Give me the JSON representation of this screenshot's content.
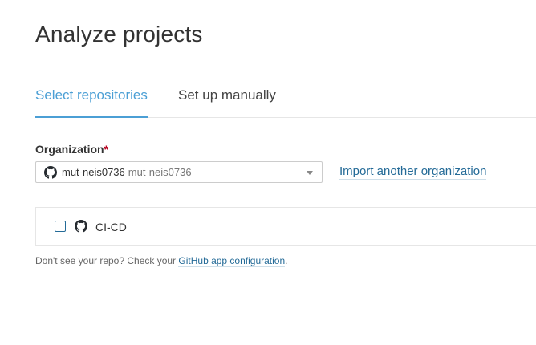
{
  "page": {
    "title": "Analyze projects"
  },
  "tabs": [
    {
      "label": "Select repositories",
      "active": true
    },
    {
      "label": "Set up manually",
      "active": false
    }
  ],
  "organization": {
    "label": "Organization",
    "required_marker": "*",
    "selected_name": "mut-neis0736",
    "selected_sub": "mut-neis0736",
    "icon": "github-icon",
    "import_link": "Import another organization"
  },
  "repositories": [
    {
      "name": "CI-CD",
      "checked": false,
      "icon": "github-icon"
    }
  ],
  "help": {
    "prefix": "Don't see your repo? Check your ",
    "link": "GitHub app configuration",
    "suffix": "."
  },
  "colors": {
    "accent": "#4b9fd5",
    "link": "#236a97",
    "required": "#b8001f"
  }
}
